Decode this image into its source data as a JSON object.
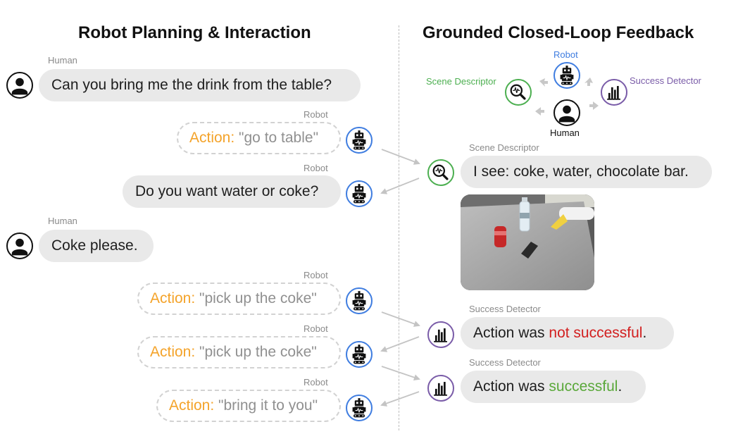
{
  "titles": {
    "left": "Robot Planning & Interaction",
    "right": "Grounded Closed-Loop Feedback"
  },
  "conversation": [
    {
      "speaker": "Human",
      "text": "Can you bring me the drink from the table?"
    },
    {
      "speaker": "Robot",
      "action_label": "Action:",
      "action_text": "\"go to table\""
    },
    {
      "speaker": "Robot",
      "text": "Do you want water or coke?"
    },
    {
      "speaker": "Human",
      "text": "Coke please."
    },
    {
      "speaker": "Robot",
      "action_label": "Action:",
      "action_text": "\"pick up the coke\""
    },
    {
      "speaker": "Robot",
      "action_label": "Action:",
      "action_text": "\"pick up the coke\""
    },
    {
      "speaker": "Robot",
      "action_label": "Action:",
      "action_text": "\"bring it to you\""
    }
  ],
  "loop_diagram": {
    "robot_label": "Robot",
    "scene_label": "Scene Descriptor",
    "success_label": "Success Detector",
    "human_label": "Human"
  },
  "feedback": [
    {
      "speaker": "Scene Descriptor",
      "text": "I see: coke, water, chocolate bar."
    },
    {
      "speaker": "Success Detector",
      "prefix": "Action was ",
      "highlight": "not successful",
      "suffix": "."
    },
    {
      "speaker": "Success Detector",
      "prefix": "Action was ",
      "highlight": "successful",
      "suffix": "."
    }
  ],
  "colors": {
    "action": "#f4a32a",
    "robot": "#3f7de0",
    "scene": "#4caf50",
    "success": "#7a5ca8",
    "fail_text": "#d21f1f",
    "success_text": "#5aa83a"
  },
  "icons": [
    "person-icon",
    "robot-icon",
    "magnifier-waveform-icon",
    "bar-chart-icon",
    "recycle-arrow-icon"
  ]
}
